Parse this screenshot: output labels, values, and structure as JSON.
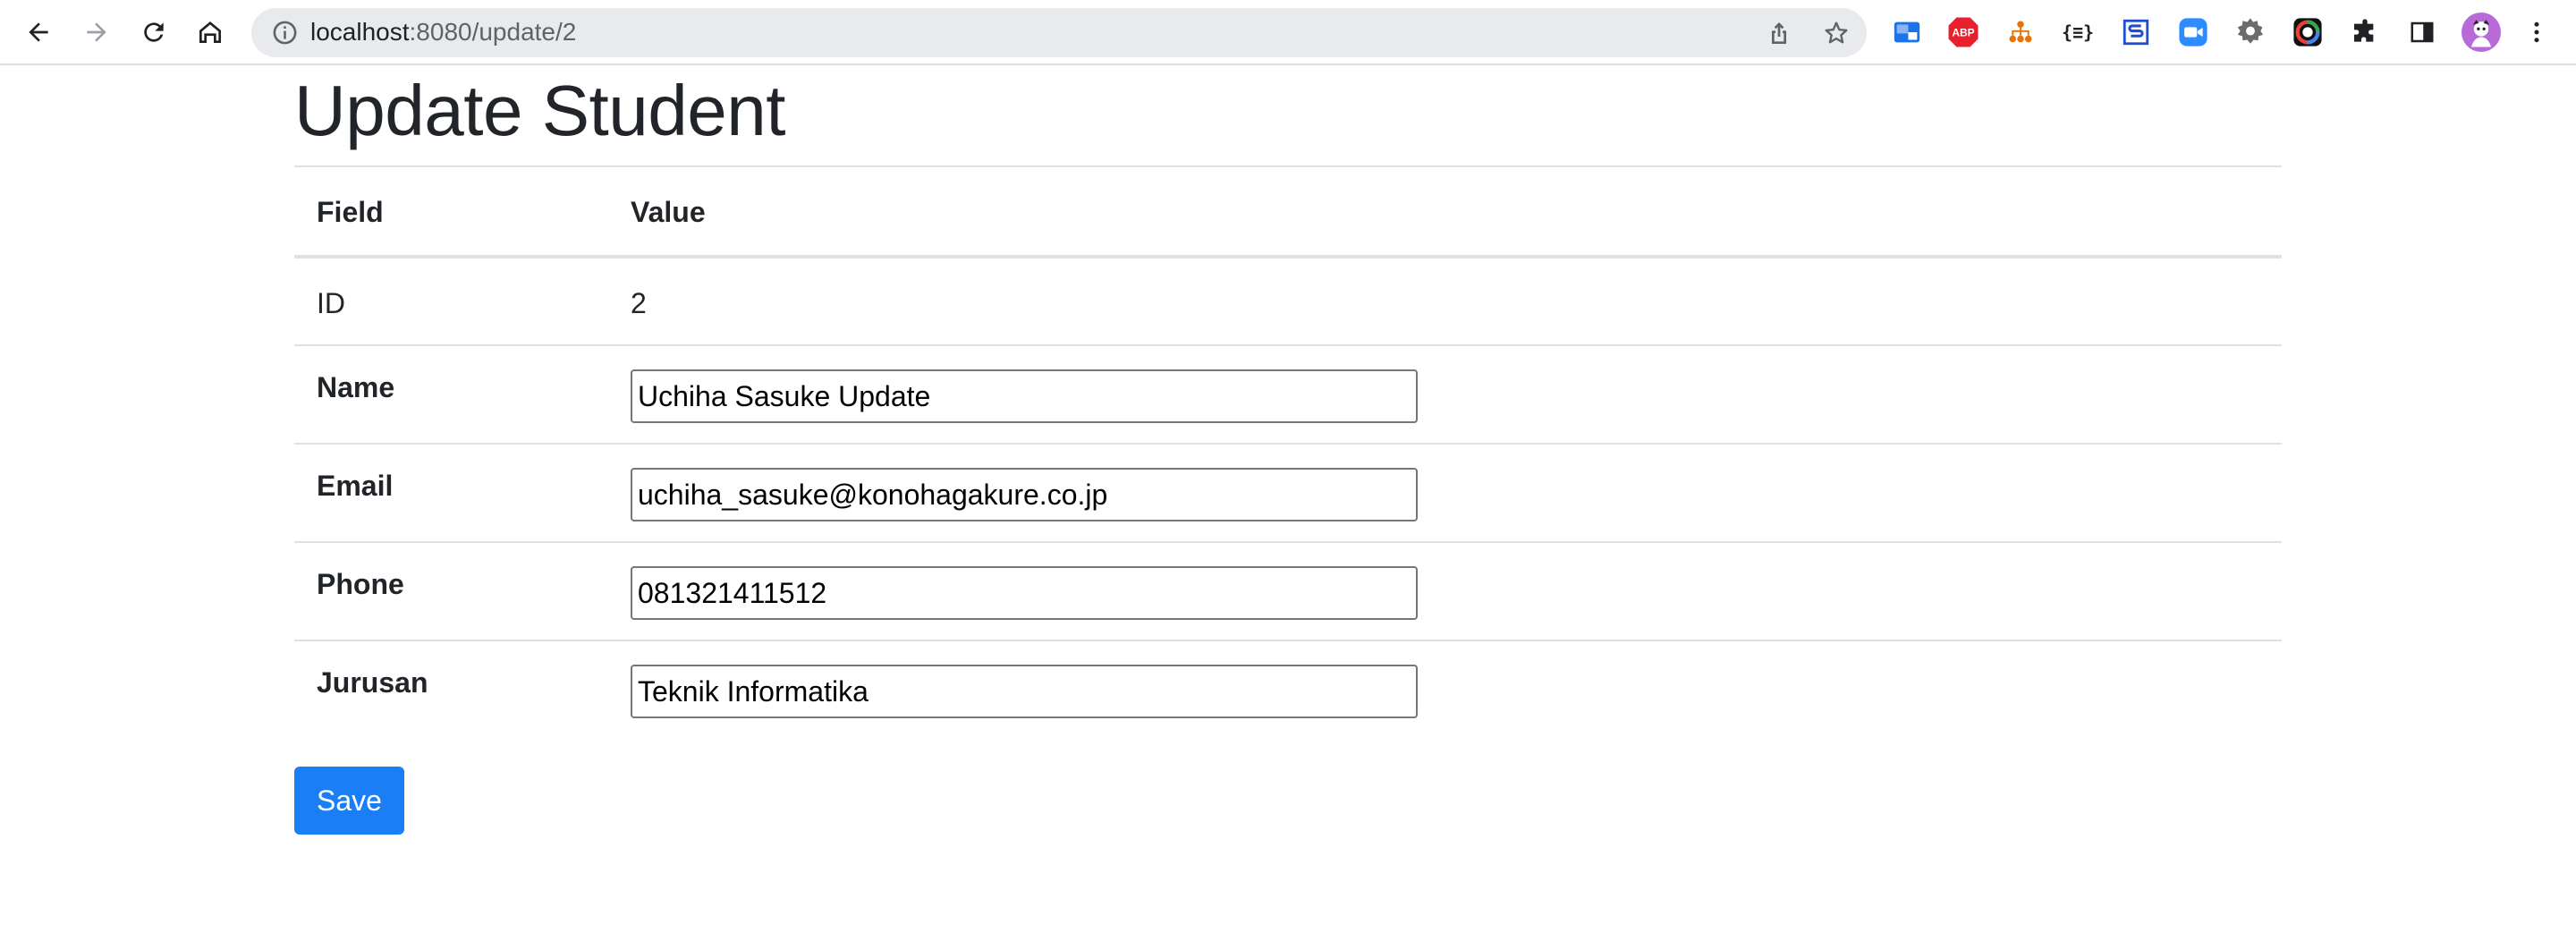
{
  "browser": {
    "url_host": "localhost",
    "url_path": ":8080/update/2",
    "nav": [
      "back-icon",
      "forward-icon",
      "reload-icon",
      "home-icon"
    ],
    "extensions": [
      "picture-in-picture-icon",
      "adblock-icon",
      "tree-icon",
      "json-icon",
      "s-icon",
      "zoom-icon",
      "gear-icon",
      "color-picker-icon",
      "puzzle-icon",
      "sidebar-icon",
      "avatar"
    ],
    "adblock_label": "ABP",
    "json_label": "{≡}"
  },
  "page": {
    "title": "Update Student",
    "table": {
      "header": {
        "field": "Field",
        "value": "Value"
      },
      "id_row": {
        "label": "ID",
        "value": "2"
      },
      "fields": [
        {
          "label": "Name",
          "value": "Uchiha Sasuke Update"
        },
        {
          "label": "Email",
          "value": "uchiha_sasuke@konohagakure.co.jp"
        },
        {
          "label": "Phone",
          "value": "081321411512"
        },
        {
          "label": "Jurusan",
          "value": "Teknik Informatika"
        }
      ]
    },
    "save_label": "Save"
  },
  "colors": {
    "accent": "#1a7ef7",
    "text": "#212529",
    "border": "#dee2e6"
  }
}
